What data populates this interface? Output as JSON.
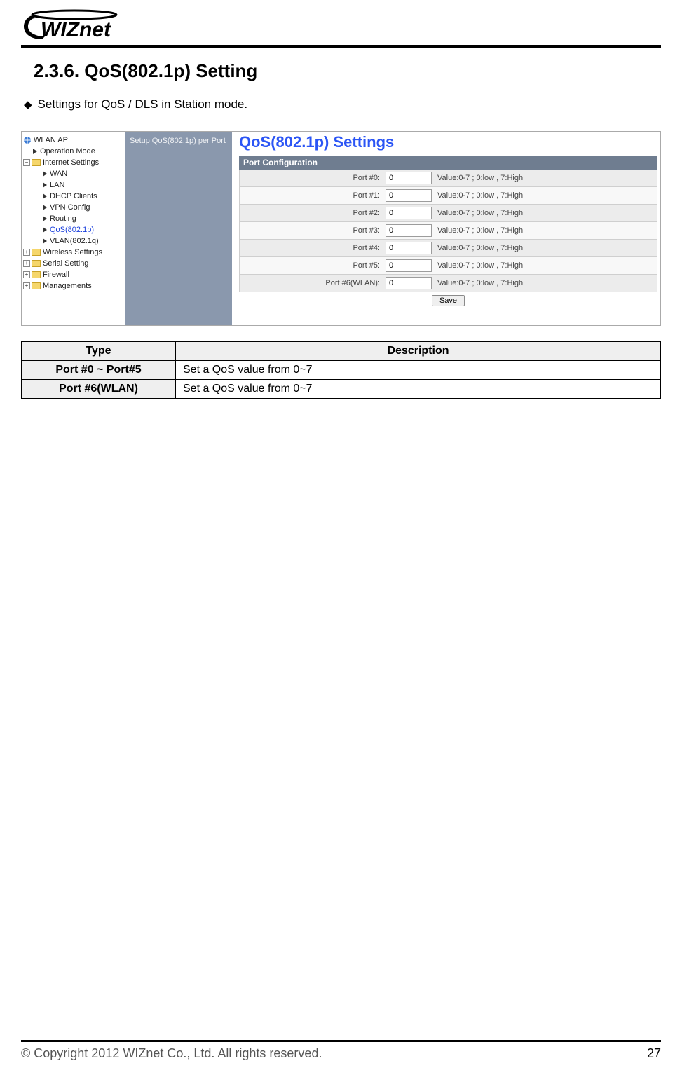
{
  "header": {
    "logo_text": "WIZnet"
  },
  "section": {
    "heading": "2.3.6.  QoS(802.1p)  Setting",
    "bullet": "Settings for QoS / DLS in Station mode."
  },
  "screenshot": {
    "tree": {
      "root": "WLAN AP",
      "items_leaf_top": [
        "Operation Mode"
      ],
      "internet_label": "Internet Settings",
      "internet_children": [
        "WAN",
        "LAN",
        "DHCP Clients",
        "VPN Config",
        "Routing",
        "QoS(802.1p)",
        "VLAN(802.1q)"
      ],
      "selected": "QoS(802.1p)",
      "other_roots": [
        "Wireless Settings",
        "Serial Setting",
        "Firewall",
        "Managements"
      ]
    },
    "mid_text": "Setup QoS(802.1p) per Port",
    "content": {
      "title": "QoS(802.1p) Settings",
      "section_bar": "Port Configuration",
      "ports": [
        {
          "label": "Port #0:",
          "value": "0",
          "hint": "Value:0-7 ; 0:low , 7:High"
        },
        {
          "label": "Port #1:",
          "value": "0",
          "hint": "Value:0-7 ; 0:low , 7:High"
        },
        {
          "label": "Port #2:",
          "value": "0",
          "hint": "Value:0-7 ; 0:low , 7:High"
        },
        {
          "label": "Port #3:",
          "value": "0",
          "hint": "Value:0-7 ; 0:low , 7:High"
        },
        {
          "label": "Port #4:",
          "value": "0",
          "hint": "Value:0-7 ; 0:low , 7:High"
        },
        {
          "label": "Port #5:",
          "value": "0",
          "hint": "Value:0-7 ; 0:low , 7:High"
        },
        {
          "label": "Port #6(WLAN):",
          "value": "0",
          "hint": "Value:0-7 ; 0:low , 7:High"
        }
      ],
      "save_label": "Save"
    }
  },
  "desc_table": {
    "headers": {
      "type": "Type",
      "description": "Description"
    },
    "rows": [
      {
        "type": "Port #0 ~ Port#5",
        "description": "Set a QoS value from 0~7"
      },
      {
        "type": "Port #6(WLAN)",
        "description": "Set a QoS value from 0~7"
      }
    ]
  },
  "footer": {
    "copyright": "© Copyright 2012 WIZnet Co., Ltd. All rights reserved.",
    "page": "27"
  }
}
